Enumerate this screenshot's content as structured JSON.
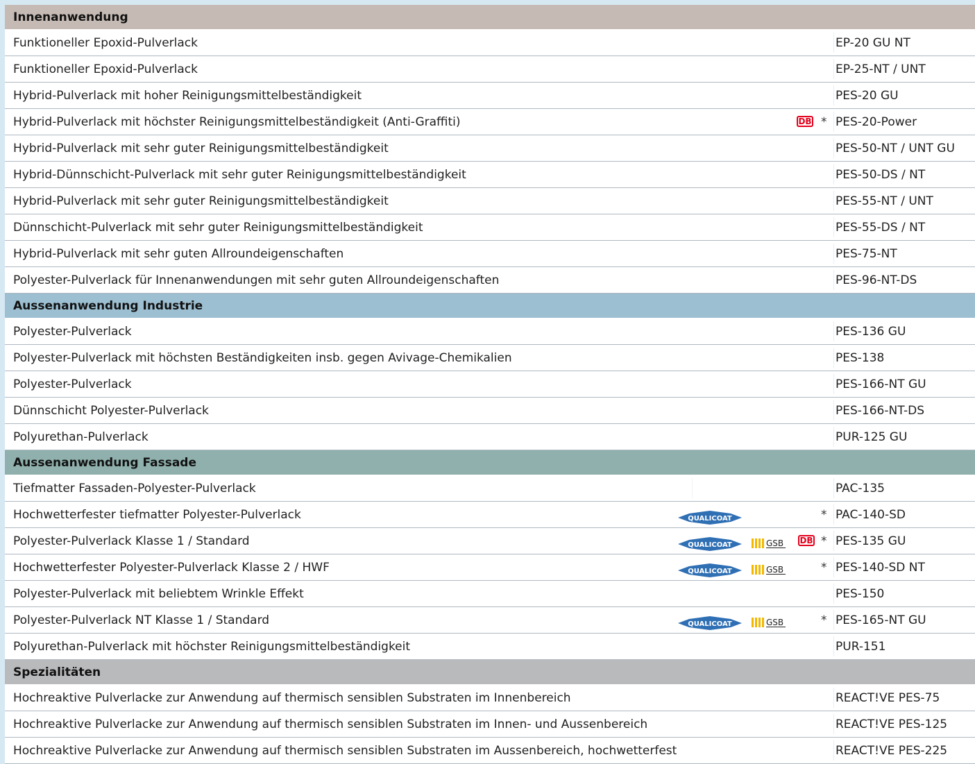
{
  "sections": [
    {
      "title": "Innenanwendung",
      "color": "#c6bbb4",
      "rows": [
        {
          "desc": "Funktioneller Epoxid-Pulverlack",
          "code": "EP-20 GU NT"
        },
        {
          "desc": "Funktioneller Epoxid-Pulverlack",
          "code": "EP-25-NT / UNT"
        },
        {
          "desc": "Hybrid-Pulverlack mit hoher Reinigungsmittelbeständigkeit",
          "code": "PES-20 GU"
        },
        {
          "desc": "Hybrid-Pulverlack mit höchster Reinigungsmittelbeständigkeit (Anti-Graffiti)",
          "code": "PES-20-Power",
          "db": "DB",
          "star": "*"
        },
        {
          "desc": "Hybrid-Pulverlack mit sehr guter Reinigungsmittelbeständigkeit",
          "code": "PES-50-NT / UNT GU"
        },
        {
          "desc": "Hybrid-Dünnschicht-Pulverlack mit sehr guter Reinigungsmittelbeständigkeit",
          "code": "PES-50-DS / NT"
        },
        {
          "desc": "Hybrid-Pulverlack mit sehr guter Reinigungsmittelbeständigkeit",
          "code": "PES-55-NT / UNT"
        },
        {
          "desc": "Dünnschicht-Pulverlack mit sehr guter Reinigungsmittelbeständigkeit",
          "code": "PES-55-DS / NT"
        },
        {
          "desc": "Hybrid-Pulverlack mit sehr guten Allroundeigenschaften",
          "code": "PES-75-NT"
        },
        {
          "desc": "Polyester-Pulverlack für Innenanwendungen mit sehr guten Allroundeigenschaften",
          "code": "PES-96-NT-DS"
        }
      ]
    },
    {
      "title": "Aussenanwendung Industrie",
      "color": "#9cbfd1",
      "rows": [
        {
          "desc": "Polyester-Pulverlack",
          "code": "PES-136 GU"
        },
        {
          "desc": "Polyester-Pulverlack mit höchsten Beständigkeiten insb. gegen Avivage-Chemikalien",
          "code": "PES-138"
        },
        {
          "desc": "Polyester-Pulverlack",
          "code": "PES-166-NT GU"
        },
        {
          "desc": "Dünnschicht Polyester-Pulverlack",
          "code": "PES-166-NT-DS"
        },
        {
          "desc": "Polyurethan-Pulverlack",
          "code": "PUR-125 GU"
        }
      ]
    },
    {
      "title": "Aussenanwendung Fassade",
      "color": "#8fb0ac",
      "rows": [
        {
          "desc": "Tiefmatter Fassaden-Polyester-Pulverlack",
          "code": "PAC-135",
          "divider": true
        },
        {
          "desc": "Hochwetterfester tiefmatter Polyester-Pulverlack",
          "code": "PAC-140-SD",
          "qualicoat": "QUALICOAT",
          "star": "*"
        },
        {
          "desc": "Polyester-Pulverlack Klasse 1 / Standard",
          "code": "PES-135 GU",
          "qualicoat": "QUALICOAT",
          "gsb": "GSB",
          "db": "DB",
          "star": "*"
        },
        {
          "desc": "Hochwetterfester Polyester-Pulverlack Klasse 2 / HWF",
          "code": "PES-140-SD NT",
          "qualicoat": "QUALICOAT",
          "gsb": "GSB",
          "star": "*"
        },
        {
          "desc": "Polyester-Pulverlack mit beliebtem Wrinkle Effekt",
          "code": "PES-150"
        },
        {
          "desc": "Polyester-Pulverlack NT Klasse 1 / Standard",
          "code": "PES-165-NT GU",
          "qualicoat": "QUALICOAT",
          "gsb": "GSB",
          "star": "*"
        },
        {
          "desc": "Polyurethan-Pulverlack mit höchster Reinigungsmittelbeständigkeit",
          "code": "PUR-151"
        }
      ]
    },
    {
      "title": "Spezialitäten",
      "color": "#b9babc",
      "rows": [
        {
          "desc": "Hochreaktive Pulverlacke zur Anwendung auf thermisch sensiblen Substraten im Innenbereich",
          "code": "REACT!VE PES-75"
        },
        {
          "desc": "Hochreaktive Pulverlacke zur Anwendung auf thermisch sensiblen Substraten im Innen- und Aussenbereich",
          "code": "REACT!VE PES-125"
        },
        {
          "desc": "Hochreaktive Pulverlacke zur Anwendung auf thermisch sensiblen Substraten im Aussenbereich, hochwetterfest",
          "code": "REACT!VE PES-225"
        }
      ]
    }
  ]
}
